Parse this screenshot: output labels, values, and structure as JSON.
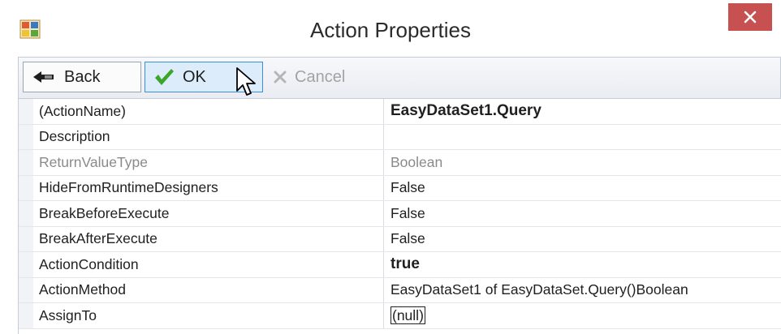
{
  "window": {
    "title": "Action Properties"
  },
  "toolbar": {
    "back_label": "Back",
    "ok_label": "OK",
    "cancel_label": "Cancel"
  },
  "properties": [
    {
      "name": "(ActionName)",
      "value": "EasyDataSet1.Query"
    },
    {
      "name": "Description",
      "value": ""
    },
    {
      "name": "ReturnValueType",
      "value": "Boolean"
    },
    {
      "name": "HideFromRuntimeDesigners",
      "value": "False"
    },
    {
      "name": "BreakBeforeExecute",
      "value": "False"
    },
    {
      "name": "BreakAfterExecute",
      "value": "False"
    },
    {
      "name": "ActionCondition",
      "value": "true"
    },
    {
      "name": "ActionMethod",
      "value": "EasyDataSet1 of EasyDataSet.Query()Boolean"
    },
    {
      "name": "AssignTo",
      "value": "(null)"
    }
  ],
  "icons": {
    "app": "app-window-icon",
    "close": "close-icon",
    "back": "back-arrow-icon",
    "ok": "checkmark-icon",
    "cancel": "x-cancel-icon",
    "cursor": "mouse-pointer-icon"
  },
  "colors": {
    "close_button": "#c75050",
    "ok_highlight": "#dcecfb",
    "ok_border": "#3a8fd8",
    "checkmark": "#3aa62a",
    "disabled_text": "#a3a3a3"
  }
}
